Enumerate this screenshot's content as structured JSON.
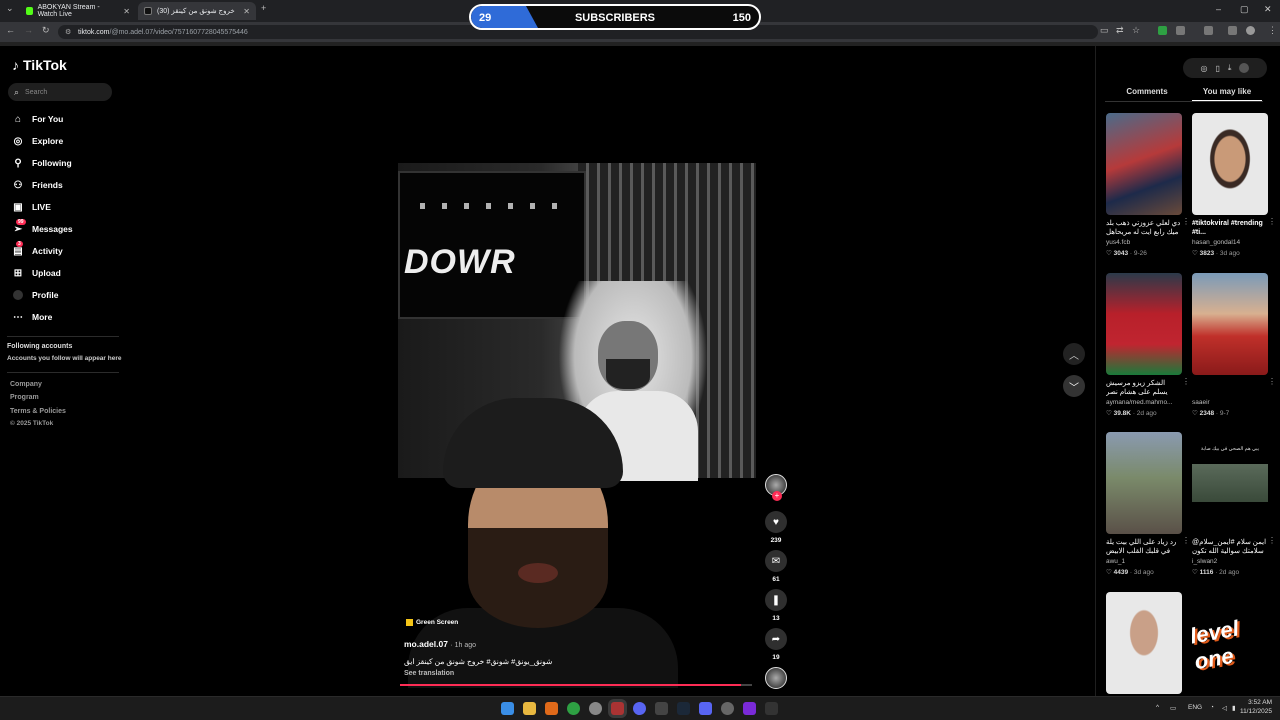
{
  "browser": {
    "tabs": [
      {
        "title": "ABOKYAN Stream - Watch Live",
        "active": false
      },
      {
        "title": "خروج شونق من كينقز (30)",
        "active": true
      }
    ],
    "url_host": "tiktok.com",
    "url_path": "/@mo.adel.07/video/7571607728045575446"
  },
  "overlay": {
    "current": "29",
    "label": "SUBSCRIBERS",
    "goal": "150",
    "progress_fraction": 0.19,
    "fill_color": "#2f6bd8"
  },
  "tiktok": {
    "logo": "TikTok",
    "search_placeholder": "Search",
    "nav": [
      {
        "label": "For You",
        "icon": "home-icon"
      },
      {
        "label": "Explore",
        "icon": "compass-icon"
      },
      {
        "label": "Following",
        "icon": "person-icon"
      },
      {
        "label": "Friends",
        "icon": "friends-icon"
      },
      {
        "label": "LIVE",
        "icon": "live-icon"
      },
      {
        "label": "Messages",
        "icon": "send-icon",
        "badge": "99"
      },
      {
        "label": "Activity",
        "icon": "inbox-icon",
        "badge": "3"
      },
      {
        "label": "Upload",
        "icon": "plus-icon"
      },
      {
        "label": "Profile",
        "icon": "profile-avatar"
      },
      {
        "label": "More",
        "icon": "more-icon"
      }
    ],
    "following_title": "Following accounts",
    "following_sub": "Accounts you follow will appear here",
    "footer": [
      "Company",
      "Program",
      "Terms & Policies",
      "© 2025 TikTok"
    ]
  },
  "video": {
    "effect": "Green Screen",
    "author": "mo.adel.07",
    "age": "· 1h ago",
    "caption": "شونق_يونق# شونق# خروج شونق من كينقز ايق",
    "see_translation": "See translation",
    "progress_fraction": 0.97,
    "tv_text": "DOWR",
    "likes": "239",
    "comments": "61",
    "saves": "13",
    "shares": "19"
  },
  "panel": {
    "tab_comments": "Comments",
    "tab_you_may_like": "You may like",
    "cards": [
      {
        "title": "دي لعلي عزوزتي ذهب بلد ميك رابع ايت له مريحاهل ولا",
        "user": "yus4.fcb",
        "likes": "3043",
        "date": "· 9-26"
      },
      {
        "title": "#tiktokviral #trending #ti...",
        "user": "hasan_gondal14",
        "likes": "3823",
        "date": "· 3d ago"
      },
      {
        "title": "الشكر زيزو مرسيش يسلم على هشام نصر وداع يحيط",
        "user": "aymana/med.mahmo...",
        "likes": "39.8K",
        "date": "· 2d ago"
      },
      {
        "title": "",
        "user": "saaeir",
        "likes": "2348",
        "date": "· 9-7"
      },
      {
        "title": "رد زياد على اللي بيت يلة في قلبك القلب الابيض",
        "user": "awu_1",
        "likes": "4439",
        "date": "· 3d ago"
      },
      {
        "title": "ايمن سلام #ايمن_سلام@ سلامتك سوالية الله تكون",
        "user": "i_slwan2",
        "likes": "1116",
        "date": "· 2d ago"
      },
      {
        "title": "",
        "user": "",
        "likes": "",
        "date": ""
      },
      {
        "title": "",
        "user": "",
        "likes": "",
        "date": ""
      }
    ],
    "card4_overlay": "يبي هم الصحي في بيك صابة"
  },
  "taskbar": {
    "lang": "ENG",
    "time": "3:52 AM",
    "date": "11/12/2025"
  }
}
